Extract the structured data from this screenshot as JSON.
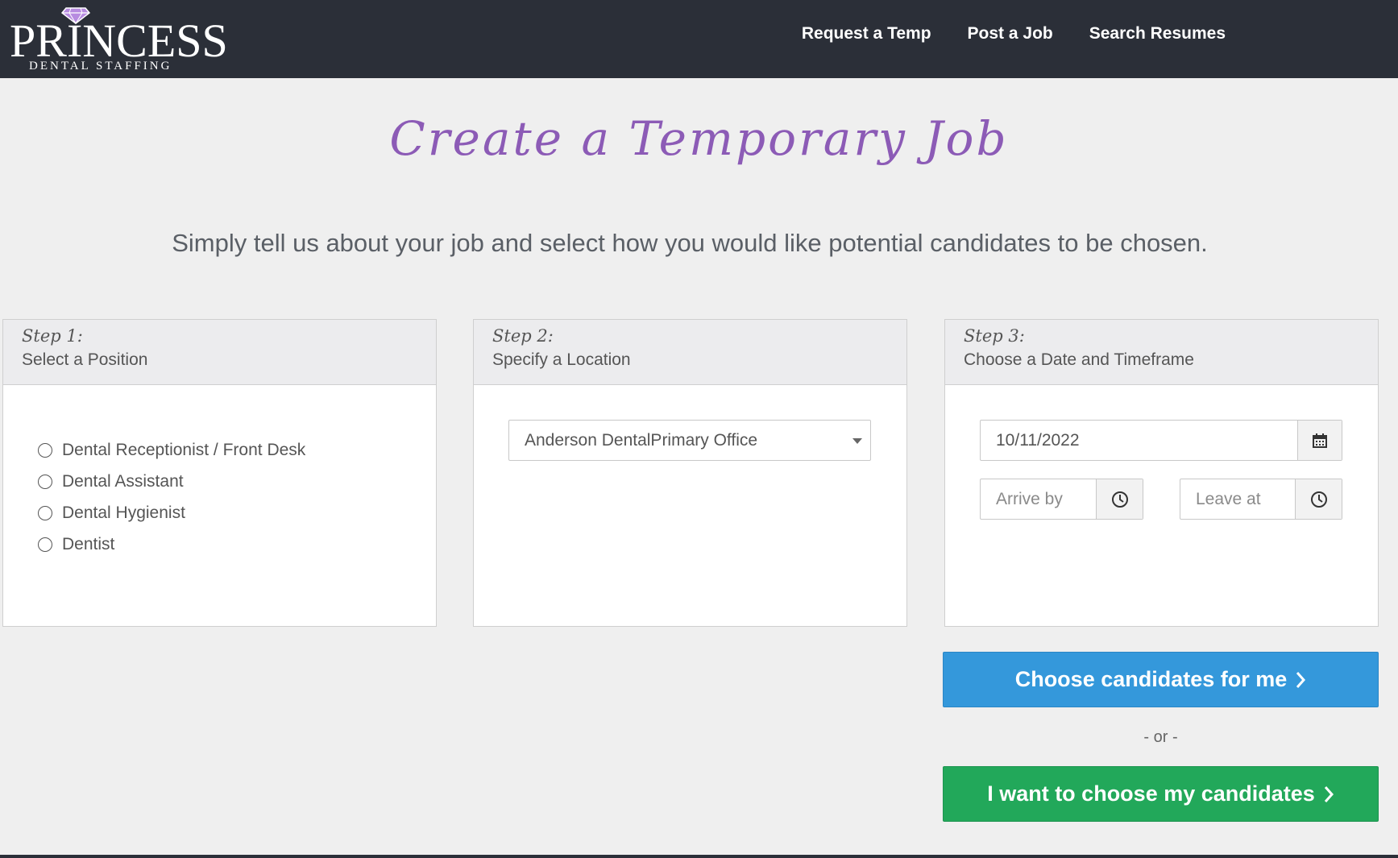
{
  "brand": {
    "name_main": "PRINCESS",
    "name_sub": "DENTAL STAFFING"
  },
  "nav": {
    "items": [
      "Request a Temp",
      "Post a Job",
      "Search Resumes"
    ]
  },
  "page": {
    "title": "Create a Temporary Job",
    "subtitle": "Simply tell us about your job and select how you would like potential candidates to be chosen."
  },
  "steps": [
    {
      "label": "Step 1:",
      "title": "Select a Position"
    },
    {
      "label": "Step 2:",
      "title": "Specify a Location"
    },
    {
      "label": "Step 3:",
      "title": "Choose a Date and Timeframe"
    }
  ],
  "positions": [
    "Dental Receptionist / Front Desk",
    "Dental Assistant",
    "Dental Hygienist",
    "Dentist"
  ],
  "location": {
    "selected": "Anderson DentalPrimary Office"
  },
  "schedule": {
    "date": "10/11/2022",
    "arrive_placeholder": "Arrive by",
    "leave_placeholder": "Leave at"
  },
  "actions": {
    "choose_for_me": "Choose candidates for me",
    "or_text": "- or -",
    "choose_myself": "I want to choose my candidates"
  },
  "colors": {
    "header_bg": "#2b2f38",
    "title_purple": "#8c5bb6",
    "primary_blue": "#3498db",
    "success_green": "#22a85a"
  }
}
